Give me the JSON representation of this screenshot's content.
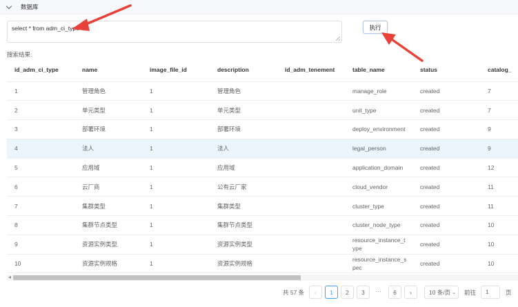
{
  "panel": {
    "title": "数据库",
    "collapse_icon": "chevron-down-icon"
  },
  "query": {
    "value": "select * from adm_ci_type"
  },
  "execute_label": "执行",
  "result_label": "搜索结果:",
  "table": {
    "columns": [
      "id_adm_ci_type",
      "name",
      "image_file_id",
      "description",
      "id_adm_tenement",
      "table_name",
      "status",
      "catalog_"
    ],
    "rows": [
      [
        "1",
        "管理角色",
        "1",
        "管理角色",
        "",
        "manage_role",
        "created",
        "7"
      ],
      [
        "2",
        "单元类型",
        "1",
        "单元类型",
        "",
        "unit_type",
        "created",
        "7"
      ],
      [
        "3",
        "部署环境",
        "1",
        "部署环境",
        "",
        "deploy_environment",
        "created",
        "9"
      ],
      [
        "4",
        "法人",
        "1",
        "法人",
        "",
        "legal_person",
        "created",
        "9"
      ],
      [
        "5",
        "应用域",
        "1",
        "应用域",
        "",
        "application_domain",
        "created",
        "12"
      ],
      [
        "6",
        "云厂商",
        "1",
        "公有云厂家",
        "",
        "cloud_vendor",
        "created",
        "11"
      ],
      [
        "7",
        "集群类型",
        "1",
        "集群类型",
        "",
        "cluster_type",
        "created",
        "11"
      ],
      [
        "8",
        "集群节点类型",
        "1",
        "集群节点类型",
        "",
        "cluster_node_type",
        "created",
        "10"
      ],
      [
        "9",
        "资源实例类型",
        "1",
        "资源实例类型",
        "",
        "resource_instance_type",
        "created",
        "10"
      ],
      [
        "10",
        "资源实例规格",
        "1",
        "资源实例规格",
        "",
        "resource_instance_spec",
        "created",
        "10"
      ]
    ],
    "highlight_row_color": "#eaf5fc"
  },
  "pagination": {
    "total": "共 57 条",
    "prev_icon": "chevron-left-icon",
    "next_icon": "chevron-right-icon",
    "pages": [
      "1",
      "2",
      "3"
    ],
    "ellipsis": "···",
    "last_page": "6",
    "current_page": 1,
    "page_size": "10 条/页",
    "goto_label": "前往",
    "goto_value": "1",
    "page_unit": "页"
  },
  "colors": {
    "accent": "#409eff",
    "annotation": "#e8413a"
  }
}
